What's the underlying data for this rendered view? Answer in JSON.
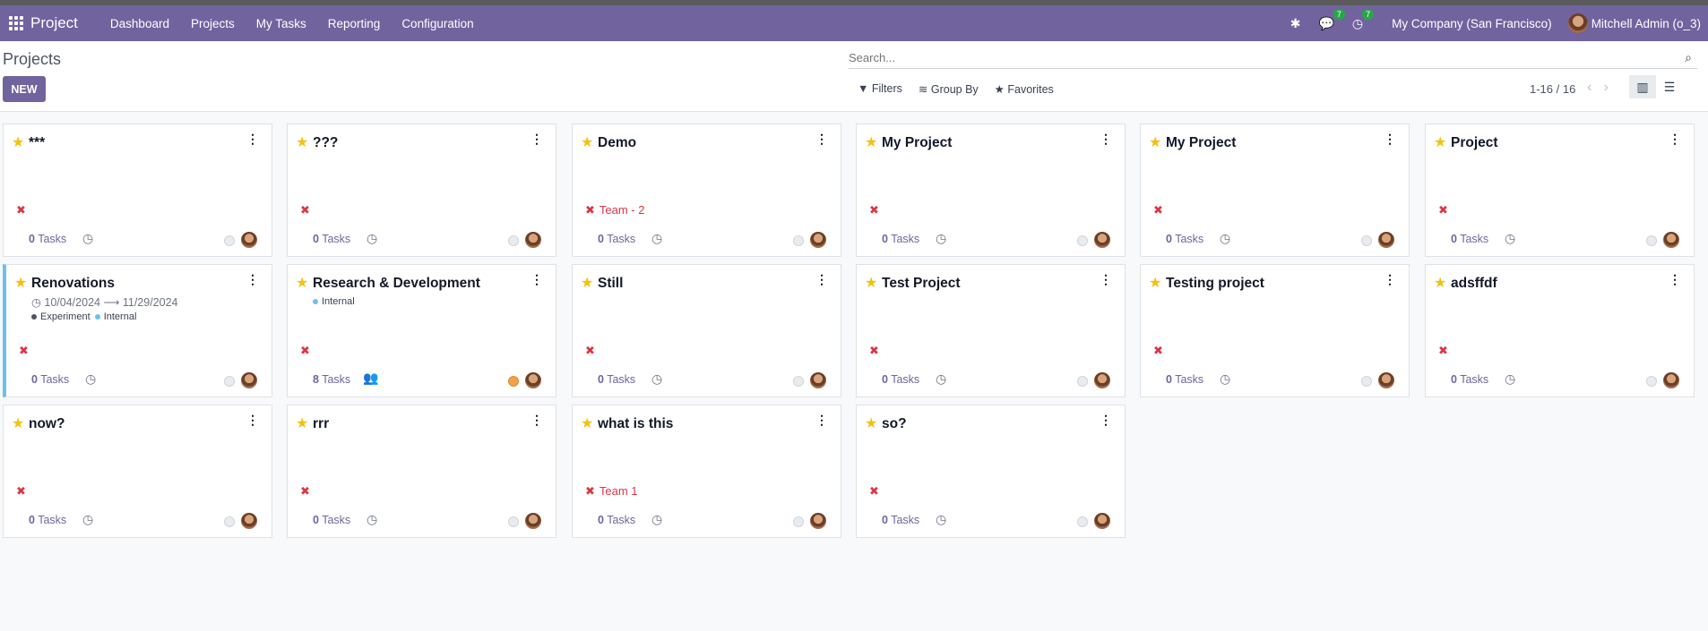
{
  "app": {
    "name": "Project"
  },
  "nav": {
    "menu": [
      "Dashboard",
      "Projects",
      "My Tasks",
      "Reporting",
      "Configuration"
    ],
    "chat_count": "7",
    "activity_count": "7",
    "company": "My Company (San Francisco)",
    "user": "Mitchell Admin (o_3)"
  },
  "control": {
    "title": "Projects",
    "new_label": "NEW",
    "search_placeholder": "Search...",
    "filters_label": "Filters",
    "groupby_label": "Group By",
    "favorites_label": "Favorites",
    "pager": "1-16 / 16"
  },
  "colors": {
    "brand": "#71639e",
    "star": "#f3c10f",
    "tag_red": "#dc3545"
  },
  "projects": [
    {
      "name": "***",
      "tasks_count": "0",
      "tasks_label": "Tasks"
    },
    {
      "name": "???",
      "tasks_count": "0",
      "tasks_label": "Tasks"
    },
    {
      "name": "Demo",
      "tag": "Team - 2",
      "tasks_count": "0",
      "tasks_label": "Tasks"
    },
    {
      "name": "My Project",
      "tasks_count": "0",
      "tasks_label": "Tasks"
    },
    {
      "name": "My Project",
      "tasks_count": "0",
      "tasks_label": "Tasks"
    },
    {
      "name": "Project",
      "tasks_count": "0",
      "tasks_label": "Tasks"
    },
    {
      "name": "Renovations",
      "date_start": "10/04/2024",
      "date_end": "11/29/2024",
      "labels": [
        "Experiment",
        "Internal"
      ],
      "tasks_count": "0",
      "tasks_label": "Tasks"
    },
    {
      "name": "Research & Development",
      "labels": [
        "Internal"
      ],
      "tasks_count": "8",
      "tasks_label": "Tasks"
    },
    {
      "name": "Still",
      "tasks_count": "0",
      "tasks_label": "Tasks"
    },
    {
      "name": "Test Project",
      "tasks_count": "0",
      "tasks_label": "Tasks"
    },
    {
      "name": "Testing project",
      "tasks_count": "0",
      "tasks_label": "Tasks"
    },
    {
      "name": "adsffdf",
      "tasks_count": "0",
      "tasks_label": "Tasks"
    },
    {
      "name": "now?",
      "tasks_count": "0",
      "tasks_label": "Tasks"
    },
    {
      "name": "rrr",
      "tasks_count": "0",
      "tasks_label": "Tasks"
    },
    {
      "name": "what is this",
      "tag": "Team 1",
      "tasks_count": "0",
      "tasks_label": "Tasks"
    },
    {
      "name": "so?",
      "tasks_count": "0",
      "tasks_label": "Tasks"
    }
  ]
}
